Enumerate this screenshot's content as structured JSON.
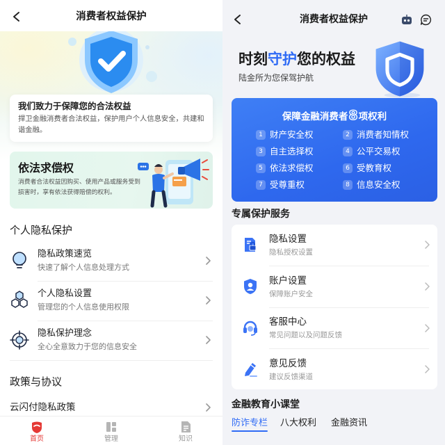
{
  "left": {
    "nav": {
      "title": "消费者权益保护",
      "back_icon": "chevron-left-icon"
    },
    "hero": {
      "icon": "shield-check-icon"
    },
    "mission": {
      "title": "我们致力于保障您的合法权益",
      "desc": "捍卫金融消费者合法权益，保护用户个人信息安全，共建和谐金融。"
    },
    "feature_card": {
      "title": "依法求偿权",
      "desc": "消费者合法权益因购买、使用产品或服务受到损害时，享有依法获得赔偿的权利。",
      "illustration": "megaphone-person-illustration"
    },
    "privacy": {
      "title": "个人隐私保护",
      "items": [
        {
          "title": "隐私政策速览",
          "desc": "快速了解个人信息处理方式",
          "icon": "lightbulb-icon"
        },
        {
          "title": "个人隐私设置",
          "desc": "管理您的个人信息使用权限",
          "icon": "hexagon-cluster-icon"
        },
        {
          "title": "隐私保护理念",
          "desc": "全心全意致力于您的信息安全",
          "icon": "target-icon"
        }
      ]
    },
    "policy": {
      "title": "政策与协议",
      "items": [
        {
          "title": "云闪付隐私政策"
        }
      ]
    },
    "tabbar": {
      "active": 0,
      "items": [
        {
          "label": "首页",
          "icon": "home-icon"
        },
        {
          "label": "管理",
          "icon": "grid-icon"
        },
        {
          "label": "知识",
          "icon": "document-icon"
        }
      ]
    },
    "colors": {
      "accent": "#e53935",
      "shield": "#2b8cf0",
      "feature_bg": "#e3f6ec"
    }
  },
  "right": {
    "nav": {
      "title": "消费者权益保护",
      "back_icon": "chevron-left-icon",
      "icons": [
        "robot-icon",
        "chat-icon"
      ]
    },
    "hero": {
      "title_pre": "时刻",
      "title_highlight": "守护",
      "title_post": "您的权益",
      "subtitle": "陆金所为您保驾护航",
      "icon": "shield-icon"
    },
    "rights_card": {
      "title_pre": "保障金融消费者",
      "count": "8",
      "title_post": "项权利",
      "items": [
        {
          "num": "1",
          "label": "财产安全权"
        },
        {
          "num": "2",
          "label": "消费者知情权"
        },
        {
          "num": "3",
          "label": "自主选择权"
        },
        {
          "num": "4",
          "label": "公平交易权"
        },
        {
          "num": "5",
          "label": "依法求偿权"
        },
        {
          "num": "6",
          "label": "受教育权"
        },
        {
          "num": "7",
          "label": "受尊重权"
        },
        {
          "num": "8",
          "label": "信息安全权"
        }
      ]
    },
    "services": {
      "title": "专属保护服务",
      "items": [
        {
          "title": "隐私设置",
          "desc": "隐私授权设置",
          "icon": "privacy-doc-icon"
        },
        {
          "title": "账户设置",
          "desc": "保障账户安全",
          "icon": "account-icon"
        },
        {
          "title": "客服中心",
          "desc": "常见问题以及问题反馈",
          "icon": "headset-icon"
        },
        {
          "title": "意见反馈",
          "desc": "建议反馈渠道",
          "icon": "pen-icon"
        }
      ]
    },
    "education": {
      "title": "金融教育小课堂",
      "active": 0,
      "tabs": [
        "防诈专栏",
        "八大权利",
        "金融资讯"
      ]
    },
    "colors": {
      "accent": "#2f6bf5",
      "card": "#2e68ee",
      "background": "#f2f3f7"
    }
  }
}
